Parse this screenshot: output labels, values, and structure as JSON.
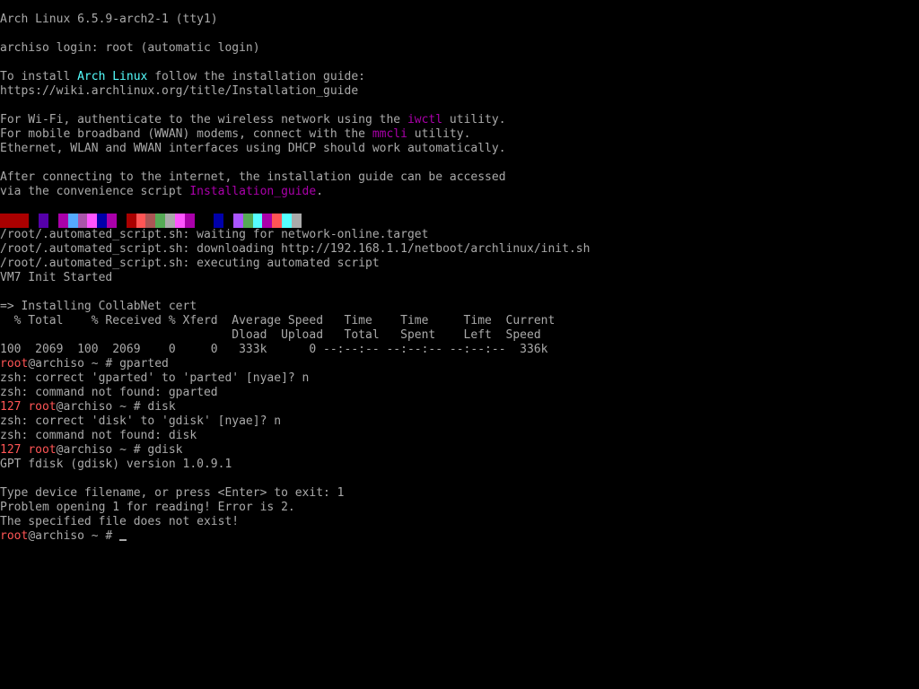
{
  "terminal": {
    "tty_header": "Arch Linux 6.5.9-arch2-1 (tty1)",
    "login_line": "archiso login: root (automatic login)",
    "install": {
      "prefix": "To install ",
      "distro": "Arch Linux",
      "suffix": " follow the installation guide:",
      "url": "https://wiki.archlinux.org/title/Installation_guide"
    },
    "wifi": {
      "prefix": "For Wi-Fi, authenticate to the wireless network using the ",
      "tool": "iwctl",
      "suffix": " utility."
    },
    "mobile": {
      "prefix": "For mobile broadband (WWAN) modems, connect with the ",
      "tool": "mmcli",
      "suffix": " utility."
    },
    "ethernet_line": "Ethernet, WLAN and WWAN interfaces using DHCP should work automatically.",
    "after_connect_line": "After connecting to the internet, the installation guide can be accessed",
    "via_script": {
      "prefix": "via the convenience script ",
      "script": "Installation_guide",
      "suffix": "."
    },
    "colorbar": [
      "#aa0000",
      "#aa0000",
      "#aa0000",
      "#000000",
      "#5500aa",
      "#000000",
      "#aa00aa",
      "#55aaff",
      "#aa55aa",
      "#ff55ff",
      "#0000aa",
      "#aa00aa",
      "#000000",
      "#aa0000",
      "#ff5555",
      "#aa5555",
      "#55aa55",
      "#aaaaaa",
      "#ff55ff",
      "#aa00aa",
      "#000000",
      "#000000",
      "#0000aa",
      "#000000",
      "#aa55ff",
      "#55aa55",
      "#55ffff",
      "#aa00aa",
      "#ff5555",
      "#55ffff",
      "#aaaaaa"
    ],
    "boot_lines": [
      "/root/.automated_script.sh: waiting for network-online.target",
      "/root/.automated_script.sh: downloading http://192.168.1.1/netboot/archlinux/init.sh",
      "/root/.automated_script.sh: executing automated script",
      "VM7 Init Started"
    ],
    "cert_line": "=> Installing CollabNet cert",
    "curl_header_1": "  % Total    % Received % Xferd  Average Speed   Time    Time     Time  Current",
    "curl_header_2": "                                 Dload  Upload   Total   Spent    Left  Speed",
    "curl_progress": "100  2069  100  2069    0     0   333k      0 --:--:-- --:--:-- --:--:--  336k",
    "prompt": {
      "user": "root",
      "rest": "@archiso ~ # "
    },
    "exit_code": "127",
    "commands": {
      "cmd1": "gparted",
      "cmd1_correct": "zsh: correct 'gparted' to 'parted' [nyae]? n",
      "cmd1_notfound": "zsh: command not found: gparted",
      "cmd2": "disk",
      "cmd2_correct": "zsh: correct 'disk' to 'gdisk' [nyae]? n",
      "cmd2_notfound": "zsh: command not found: disk",
      "cmd3": "gdisk",
      "gdisk_version": "GPT fdisk (gdisk) version 1.0.9.1",
      "gdisk_prompt": "Type device filename, or press <Enter> to exit: 1",
      "gdisk_error": "Problem opening 1 for reading! Error is 2.",
      "gdisk_notexist": "The specified file does not exist!"
    }
  }
}
